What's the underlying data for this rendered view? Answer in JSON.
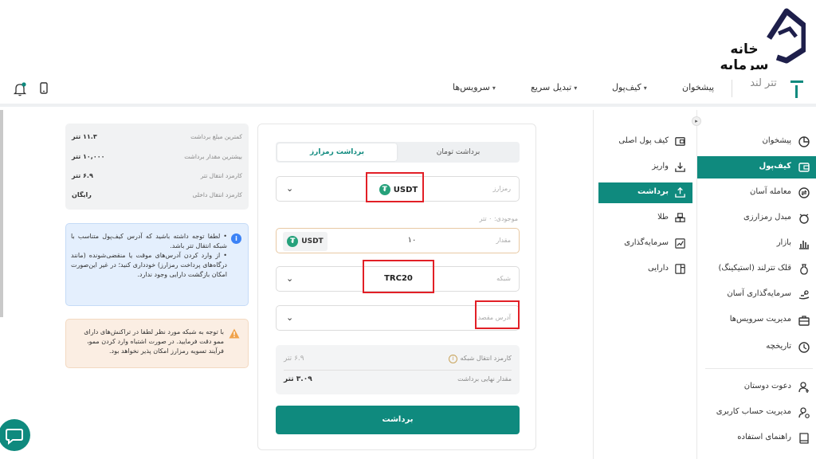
{
  "brand": {
    "logo_text": "خانه سرمایه"
  },
  "navbar": {
    "logo_text": "تتر لند",
    "items": [
      {
        "label": "پیشخوان"
      },
      {
        "label": "کیف‌پول"
      },
      {
        "label": "تبدیل سریع"
      },
      {
        "label": "سرویس‌ها"
      }
    ],
    "icons": [
      "notification-bell-icon",
      "mobile-icon"
    ]
  },
  "sidebar": {
    "items": [
      {
        "label": "پیشخوان",
        "icon": "dashboard-icon"
      },
      {
        "label": "کیف‌پول",
        "icon": "wallet-icon",
        "active": true
      },
      {
        "label": "معامله آسان",
        "icon": "exchange-icon"
      },
      {
        "label": "مبدل رمزارزی",
        "icon": "converter-icon"
      },
      {
        "label": "بازار",
        "icon": "market-icon"
      },
      {
        "label": "قلک تترلند (استیکینگ)",
        "icon": "piggy-bank-icon"
      },
      {
        "label": "سرمایه‌گذاری آسان",
        "icon": "investment-icon"
      },
      {
        "label": "مدیریت سرویس‌ها",
        "icon": "services-icon"
      },
      {
        "label": "تاریخچه",
        "icon": "history-icon"
      },
      {
        "label": "دعوت دوستان",
        "icon": "invite-icon"
      },
      {
        "label": "مدیریت حساب کاربری",
        "icon": "account-icon"
      },
      {
        "label": "راهنمای استفاده",
        "icon": "guide-icon"
      }
    ]
  },
  "submenu": {
    "items": [
      {
        "label": "کیف پول اصلی",
        "icon": "main-wallet-icon"
      },
      {
        "label": "واریز",
        "icon": "deposit-icon"
      },
      {
        "label": "برداشت",
        "icon": "withdraw-icon",
        "active": true
      },
      {
        "label": "طلا",
        "icon": "gold-icon"
      },
      {
        "label": "سرمایه‌گذاری",
        "icon": "investment-chart-icon"
      },
      {
        "label": "دارایی",
        "icon": "assets-icon"
      }
    ]
  },
  "form": {
    "tabs": {
      "crypto": "برداشت رمزارز",
      "toman": "برداشت تومان"
    },
    "currency": {
      "label": "رمزارز",
      "value": "USDT"
    },
    "available": "موجودی: ۰ تتر",
    "amount": {
      "label": "مقدار",
      "value": "۱۰",
      "unit": "USDT"
    },
    "network": {
      "label": "شبکه",
      "value": "TRC20"
    },
    "address": {
      "placeholder": "آدرس مقصد"
    },
    "fees": {
      "network_fee_label": "کارمزد انتقال شبکه",
      "network_fee_value": "۶.۹ تتر",
      "final_label": "مقدار نهایی برداشت",
      "final_value": "۳.۰۹ تتر"
    },
    "submit": "برداشت"
  },
  "limits": [
    {
      "label": "کمترین مبلغ برداشت",
      "value": "۱۱.۳ تتر"
    },
    {
      "label": "بیشترین مقدار برداشت",
      "value": "۱۰,۰۰۰ تتر"
    },
    {
      "label": "کارمزد انتقال تتر",
      "value": "۶.۹ تتر"
    },
    {
      "label": "کارمزد انتقال داخلی",
      "value": "رایگان"
    }
  ],
  "notices": {
    "info": [
      "لطفا توجه داشته باشید که آدرس کیف‌پول متناسب با شبکه انتقال تتر باشد.",
      "از وارد کردن آدرس‌های موقت یا منقضی‌شونده (مانند درگاه‌های پرداخت رمزارز) خودداری کنید؛ در غیر این‌صورت امکان بازگشت دارایی وجود ندارد."
    ],
    "warning": "با توجه به شبکه مورد نظر لطفا در تراکنش‌های دارای ممو دقت فرمایید. در صورت اشتباه وارد کردن ممو، فرآیند تسویه رمزارز امکان پذیر نخواهد بود."
  },
  "colors": {
    "brand": "#0f8a7e",
    "highlight": "#e21f26",
    "tether": "#26a17b"
  }
}
